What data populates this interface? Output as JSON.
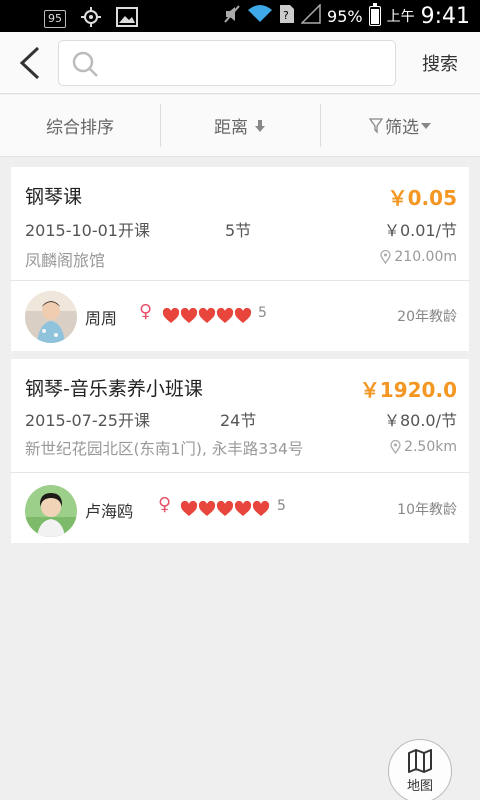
{
  "status_bar": {
    "badge": "95",
    "battery_pct": "95%",
    "ampm": "上午",
    "time": "9:41"
  },
  "search": {
    "value": "",
    "placeholder": "",
    "button_label": "搜索"
  },
  "filters": [
    {
      "label": "综合排序"
    },
    {
      "label": "距离"
    },
    {
      "label": "筛选"
    }
  ],
  "courses": [
    {
      "title": "钢琴课",
      "price": "￥0.05",
      "date": "2015-10-01开课",
      "lessons": "5节",
      "unit_price": "￥0.01/节",
      "venue": "凤麟阁旅馆",
      "distance": "210.00m",
      "teacher": {
        "name": "周周",
        "gender": "♀",
        "hearts": 5,
        "rating_count": "5",
        "years": "20年教龄"
      }
    },
    {
      "title": "钢琴-音乐素养小班课",
      "price": "￥1920.0",
      "date": "2015-07-25开课",
      "lessons": "24节",
      "unit_price": "￥80.0/节",
      "venue": "新世纪花园北区(东南1门), 永丰路334号",
      "distance": "2.50km",
      "teacher": {
        "name": "卢海鸥",
        "gender": "♀",
        "hearts": 5,
        "rating_count": "5",
        "years": "10年教龄"
      }
    }
  ],
  "map_button": {
    "label": "地图"
  },
  "colors": {
    "accent": "#f39722",
    "heart": "#e8453c",
    "gender": "#e8526a"
  }
}
